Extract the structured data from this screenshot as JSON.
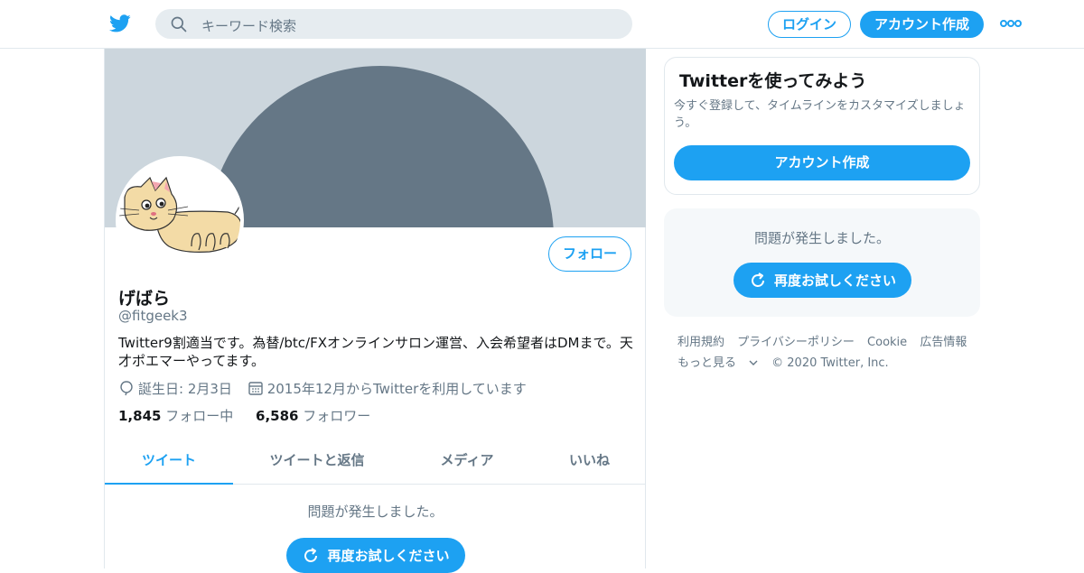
{
  "topbar": {
    "search_placeholder": "キーワード検索",
    "login_label": "ログイン",
    "signup_label": "アカウント作成"
  },
  "profile": {
    "name": "げばら",
    "handle": "@fitgeek3",
    "bio": "Twitter9割適当です。為替/btc/FXオンラインサロン運営、入会希望者はDMまで。天才ポエマーやってます。",
    "birthday": "誕生日: 2月3日",
    "joined": "2015年12月からTwitterを利用しています",
    "following_count": "1,845",
    "following_label": "フォロー中",
    "followers_count": "6,586",
    "followers_label": "フォロワー",
    "follow_button": "フォロー"
  },
  "tabs": [
    {
      "label": "ツイート",
      "active": true
    },
    {
      "label": "ツイートと返信",
      "active": false
    },
    {
      "label": "メディア",
      "active": false
    },
    {
      "label": "いいね",
      "active": false
    }
  ],
  "main_error": {
    "message": "問題が発生しました。",
    "retry_label": "再度お試しください"
  },
  "sidebar": {
    "promo_title": "Twitterを使ってみよう",
    "promo_desc": "今すぐ登録して、タイムラインをカスタマイズしましょう。",
    "promo_signup": "アカウント作成",
    "error_message": "問題が発生しました。",
    "error_retry": "再度お試しください"
  },
  "footer": {
    "links": [
      "利用規約",
      "プライバシーポリシー",
      "Cookie",
      "広告情報"
    ],
    "more": "もっと見る",
    "copyright": "© 2020 Twitter, Inc."
  },
  "colors": {
    "accent": "#1da1f2",
    "banner_bg": "#ccd6dd",
    "banner_circle": "#657786",
    "secondary_text": "#657786"
  },
  "icons": [
    "twitter-bird-icon",
    "search-icon",
    "more-dots-icon",
    "balloon-icon",
    "calendar-icon",
    "refresh-icon",
    "chevron-down-icon"
  ]
}
